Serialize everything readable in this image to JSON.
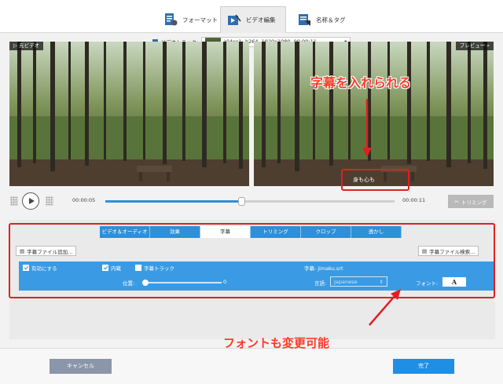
{
  "top_tabs": [
    {
      "label": "フォーマット",
      "icon": "format-icon"
    },
    {
      "label": "ビデオ編集",
      "icon": "video-edit-icon",
      "active": true
    },
    {
      "label": "名称＆タグ",
      "icon": "tag-icon"
    }
  ],
  "track": {
    "label": "ビデオトラック:",
    "value": "Video1: h264, 1920x1080, 00:00:11"
  },
  "preview": {
    "left_label": "元ビデオ",
    "right_label": "プレビュー",
    "subtitle_text": "身も心も"
  },
  "playback": {
    "current_time": "00:00:05",
    "end_time": "00:00:11",
    "progress": 0.47,
    "trim_label": "トリミング"
  },
  "edit_tabs": [
    {
      "label": "ビデオ＆オーディオ"
    },
    {
      "label": "効果"
    },
    {
      "label": "字幕",
      "active": true
    },
    {
      "label": "トリミング"
    },
    {
      "label": "クロップ"
    },
    {
      "label": "透かし"
    }
  ],
  "subtitle_panel": {
    "add_file_label": "字幕ファイル追加...",
    "search_file_label": "字幕ファイル検索...",
    "enable_label": "有効にする",
    "builtin_label": "内蔵",
    "track_label": "字幕トラック",
    "file_label": "字幕: jimaku.srt",
    "position_label": "位置:",
    "position_value": "0",
    "language_label": "言語:",
    "language_value": "Japanese",
    "font_label": "フォント:",
    "font_button": "A"
  },
  "annotations": {
    "top": "字幕を入れられる",
    "bottom": "フォントも変更可能"
  },
  "buttons": {
    "cancel": "キャンセル",
    "done": "完了"
  },
  "colors": {
    "accent": "#2f8fd8",
    "annotation": "#e02020"
  }
}
